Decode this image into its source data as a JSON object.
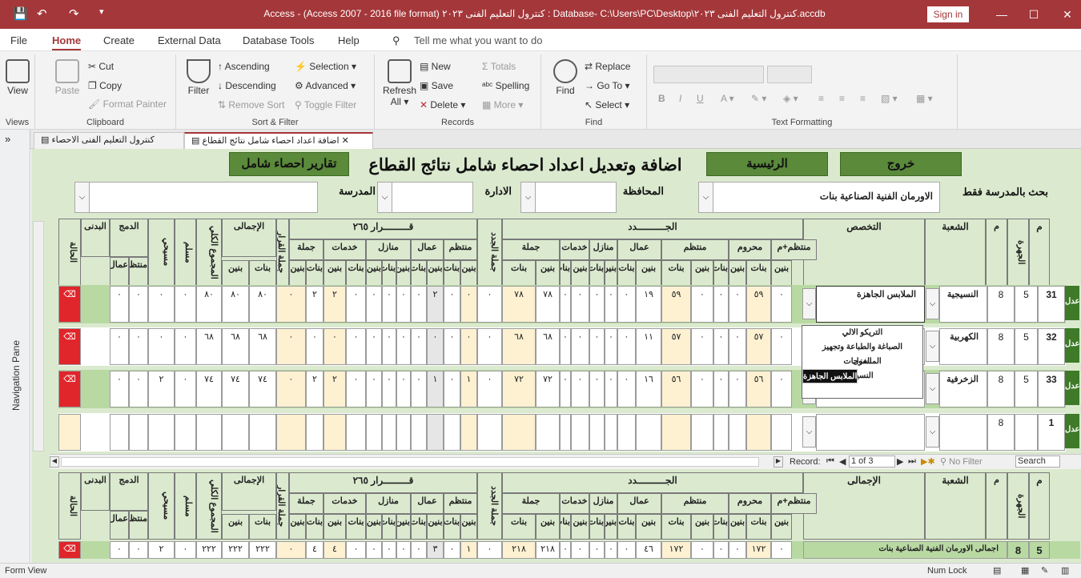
{
  "titlebar": {
    "title": "Access - (Access 2007 - 2016 file format) كنترول التعليم الفنى ٢٠٢٣ : Database- C:\\Users\\PC\\Desktop\\كنترول التعليم الفنى ٢٠٢٣.accdb",
    "sign_in": "Sign in",
    "minimize": "—",
    "maximize": "☐",
    "close": "✕"
  },
  "menu": {
    "items": [
      "File",
      "Home",
      "Create",
      "External Data",
      "Database Tools",
      "Help"
    ],
    "tell_me": "Tell me what you want to do"
  },
  "ribbon": {
    "views": {
      "view": "View",
      "group": "Views"
    },
    "clipboard": {
      "paste": "Paste",
      "cut": "Cut",
      "copy": "Copy",
      "format_painter": "Format Painter",
      "group": "Clipboard"
    },
    "sort_filter": {
      "filter": "Filter",
      "ascending": "Ascending",
      "descending": "Descending",
      "remove_sort": "Remove Sort",
      "selection": "Selection",
      "advanced": "Advanced",
      "toggle_filter": "Toggle Filter",
      "group": "Sort & Filter"
    },
    "records": {
      "refresh": "Refresh",
      "refresh2": "All",
      "new": "New",
      "save": "Save",
      "delete": "Delete",
      "totals": "Totals",
      "spelling": "Spelling",
      "more": "More",
      "group": "Records"
    },
    "find": {
      "find": "Find",
      "replace": "Replace",
      "goto": "Go To",
      "select": "Select",
      "group": "Find"
    },
    "text_formatting": {
      "bold": "B",
      "italic": "I",
      "underline": "U",
      "group": "Text Formatting"
    }
  },
  "tabs": [
    {
      "label": "كنترول التعليم الفنى الاحصاء"
    },
    {
      "label": "اضافة اعداد احصاء شامل نتائج القطاع"
    }
  ],
  "nav_pane": {
    "label": "Navigation Pane",
    "toggle": "»"
  },
  "form": {
    "buttons": {
      "exit": "خروج",
      "main": "الرئيسية",
      "reports": "تقارير احصاء شامل"
    },
    "title": "اضافة وتعديل اعداد احصاء شامل نتائج القطاع",
    "filters": {
      "school_only": "بحث بالمدرسة فقط",
      "school_value": "الاورمان الفنية الصناعية بنات",
      "governorate": "المحافظة",
      "administration": "الادارة",
      "school": "المدرسة"
    },
    "headers": {
      "m": "م",
      "grade": "الجهرة",
      "code": "م",
      "division": "الشعبة",
      "specialty": "التخصص",
      "new": "الجــــــــــدد",
      "regular_plus": "منتظم+م",
      "deprived": "محروم",
      "regular": "منتظم",
      "workers": "عمال",
      "homes": "منازل",
      "services": "خدمات",
      "total": "جملة",
      "new_total": "جملة الجدد",
      "decision": "قـــــــــرار ٢٦٥",
      "decision_total": "جملة القرار",
      "grand": "الإجمالى",
      "overall_total": "المجموع الكلي",
      "muslim": "مسلم",
      "christian": "مسيحي",
      "merge": "الدمج",
      "merge_regular": "منتظم",
      "merge_workers": "عمال",
      "physical": "البدنى",
      "status": "الحالة",
      "boys": "بنين",
      "girls": "بنات"
    },
    "rows": [
      {
        "strip": "عدل",
        "m": "31",
        "grade": "5",
        "code": "8",
        "division": "النسيجية",
        "specialty": "الملابس الجاهزة",
        "vals": [
          "٠",
          "٥٩",
          "٠",
          "٠",
          "٠",
          "٥٩",
          "١٩",
          "٠",
          "٠",
          "٠",
          "٠",
          "٠",
          "٧٨",
          "٧٨",
          "٠",
          "٠",
          "٠",
          "٢",
          "٠",
          "٠",
          "٠",
          "٠",
          "٠",
          "٢",
          "٢",
          "٠",
          "٨٠",
          "٨٠",
          "٨٠",
          "٠",
          "٠",
          "٠",
          "٠"
        ]
      },
      {
        "strip": "عدل",
        "m": "32",
        "grade": "5",
        "code": "8",
        "division": "الكهربية",
        "specialty": "",
        "vals": [
          "٠",
          "٥٧",
          "٠",
          "٠",
          "٠",
          "٥٧",
          "١١",
          "٠",
          "٠",
          "٠",
          "٠",
          "٠",
          "٦٨",
          "٦٨",
          "٠",
          "٠",
          "٠",
          "٠",
          "٠",
          "٠",
          "٠",
          "٠",
          "٠",
          "٠",
          "٠",
          "٠",
          "٦٨",
          "٦٨",
          "٦٨",
          "٠",
          "٠",
          "٠",
          "٠"
        ]
      },
      {
        "strip": "عدل",
        "m": "33",
        "grade": "5",
        "code": "8",
        "division": "الزخرفية",
        "specialty": "",
        "vals": [
          "٠",
          "٥٦",
          "٠",
          "٠",
          "٠",
          "٥٦",
          "١٦",
          "٠",
          "٠",
          "٠",
          "٠",
          "٠",
          "٧٢",
          "٧٢",
          "٠",
          "١",
          "٠",
          "١",
          "٠",
          "٠",
          "٠",
          "٠",
          "٠",
          "٢",
          "٢",
          "٠",
          "٧٤",
          "٧٤",
          "٧٤",
          "٠",
          "٢",
          "٠",
          "٠"
        ]
      },
      {
        "strip": "عدل",
        "m": "1",
        "grade": "",
        "code": "8",
        "division": "",
        "specialty": "",
        "vals": [
          "",
          "",
          "",
          "",
          "",
          "",
          "",
          "",
          "",
          "",
          "",
          "",
          "",
          "",
          "",
          "",
          "",
          "",
          "",
          "",
          "",
          "",
          "",
          "",
          "",
          "",
          "",
          "",
          "",
          "",
          "",
          "",
          ""
        ]
      }
    ],
    "dropdown_options": [
      "التريكو الالي",
      "الصباغة والطباعة وتجهيز المنسوجات",
      "الغزل",
      "الملابس الجاهزة",
      "النسيج"
    ],
    "dropdown_selected": 3,
    "record_nav": {
      "label": "Record:",
      "current": "1 of 3",
      "no_filter": "No Filter",
      "search": "Search"
    },
    "footer": {
      "grand_label": "الإجمالى",
      "row_grade": "5",
      "row_code": "8",
      "row_label": "اجمالى الاورمان الفنية الصناعية بنات",
      "vals": [
        "٠",
        "١٧٢",
        "٠",
        "٠",
        "٠",
        "١٧٢",
        "٤٦",
        "٠",
        "٠",
        "٠",
        "٠",
        "٠",
        "٢١٨",
        "٢١٨",
        "٠",
        "١",
        "٠",
        "٣",
        "٠",
        "٠",
        "٠",
        "٠",
        "٠",
        "٤",
        "٤",
        "٠",
        "٢٢٢",
        "٢٢٢",
        "٢٢٢",
        "٠",
        "٢",
        "٠",
        "٠"
      ]
    }
  },
  "statusbar": {
    "left": "Form View",
    "right": "Num Lock"
  }
}
